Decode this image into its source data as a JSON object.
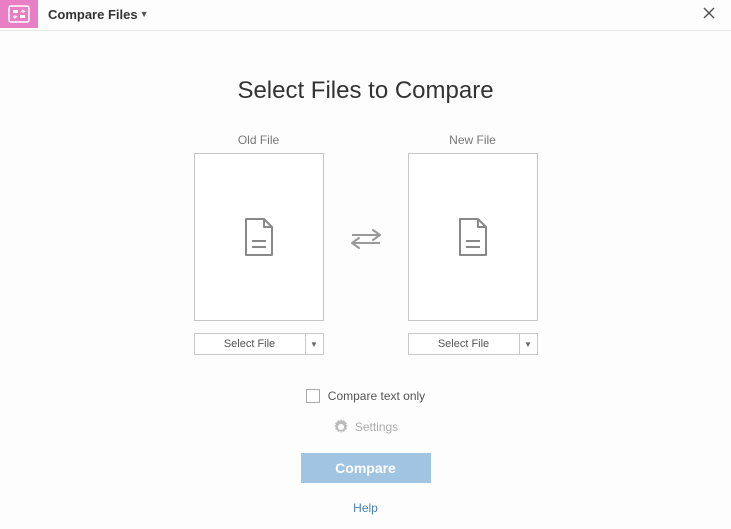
{
  "header": {
    "title": "Compare Files"
  },
  "main": {
    "heading": "Select Files to Compare",
    "old_label": "Old File",
    "new_label": "New File",
    "select_button": "Select File"
  },
  "options": {
    "compare_text_only": "Compare text only",
    "settings": "Settings",
    "compare_button": "Compare",
    "help": "Help"
  }
}
